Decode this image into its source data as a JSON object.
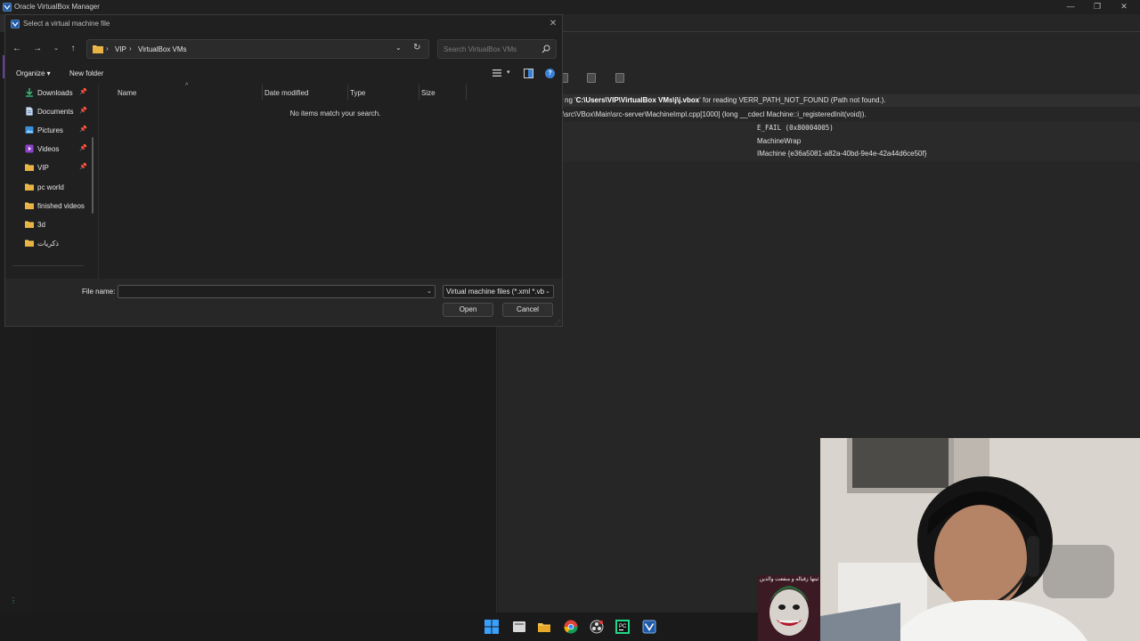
{
  "vbox": {
    "title": "Oracle VirtualBox Manager",
    "window_controls": {
      "minimize": "—",
      "maximize": "❐",
      "close": "✕"
    },
    "error": {
      "line1_prefix": "ng '",
      "line1_path": "C:\\Users\\VIP\\VirtualBox VMs\\j\\j.vbox",
      "line1_suffix": "' for reading VERR_PATH_NOT_FOUND (Path not found.).",
      "line2": "\\src\\VBox\\Main\\src-server\\MachineImpl.cpp[1000] (long __cdecl Machine::i_registeredInit(void)).",
      "result_code": "E_FAIL (0x80004005)",
      "component": "MachineWrap",
      "interface": "IMachine {e36a5081-a82a-40bd-9e4e-42a44d6ce50f}"
    }
  },
  "dialog": {
    "title": "Select a virtual machine file",
    "close": "✕",
    "nav": {
      "back": "←",
      "forward": "→",
      "recent": "⌄",
      "up": "↑"
    },
    "address": {
      "crumbs": [
        "VIP",
        "VirtualBox VMs"
      ],
      "separator": "›",
      "dropdown": "⌄",
      "refresh": "↻"
    },
    "search": {
      "placeholder": "Search VirtualBox VMs"
    },
    "commands": {
      "organize": "Organize ▾",
      "new_folder": "New folder",
      "view_chevron": "▾",
      "help": "?"
    },
    "nav_items": [
      {
        "label": "Downloads",
        "icon": "download-icon",
        "pinned": true
      },
      {
        "label": "Documents",
        "icon": "document-icon",
        "pinned": true
      },
      {
        "label": "Pictures",
        "icon": "picture-icon",
        "pinned": true
      },
      {
        "label": "Videos",
        "icon": "video-icon",
        "pinned": true
      },
      {
        "label": "VIP",
        "icon": "folder-icon",
        "pinned": true
      },
      {
        "label": "pc world",
        "icon": "folder-icon",
        "pinned": false
      },
      {
        "label": "finished videos",
        "icon": "folder-icon",
        "pinned": false
      },
      {
        "label": "3d",
        "icon": "folder-icon",
        "pinned": false
      },
      {
        "label": "ذكريات",
        "icon": "folder-icon",
        "pinned": false
      }
    ],
    "pin_glyph": "📌",
    "columns": {
      "name": "Name",
      "date": "Date modified",
      "type": "Type",
      "size": "Size",
      "sort_glyph": "^"
    },
    "empty_message": "No items match your search.",
    "file_name_label": "File name:",
    "file_name_value": "",
    "filter": "Virtual machine files (*.xml *.vb",
    "chevron": "⌄",
    "open": "Open",
    "cancel": "Cancel",
    "resize_grip": "⋰"
  },
  "sticker": {
    "text": "ثبتها زقياله و منفعت والدين"
  },
  "colors": {
    "folder": "#e8b343",
    "accent": "#3b82d8"
  }
}
